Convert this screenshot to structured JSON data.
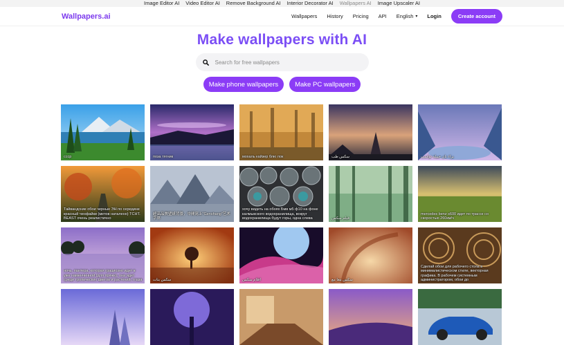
{
  "topbar": {
    "links": [
      "Image Editor AI",
      "Video Editor AI",
      "Remove Background AI",
      "Interior Decorator AI",
      "Wallpapers AI",
      "Image Upscaler AI"
    ],
    "active_index": 4
  },
  "header": {
    "logo": "Wallpapers.ai",
    "nav": {
      "wallpapers": "Wallpapers",
      "history": "History",
      "pricing": "Pricing",
      "api": "API",
      "language": "English",
      "login": "Login",
      "create_account": "Create account"
    }
  },
  "hero": {
    "title": "Make wallpapers with AI",
    "search_placeholder": "Search for free wallpapers",
    "phone_button": "Make phone wallpapers",
    "pc_button": "Make PC wallpapers"
  },
  "colors": {
    "brand": "#8b3cf6",
    "title": "#7b4ef5"
  },
  "gallery": [
    {
      "caption": "ссср",
      "scene": "mountain-lake"
    },
    {
      "caption": "поза тягник",
      "scene": "purple-shore"
    },
    {
      "caption": "мохаль кайзер блю лок",
      "scene": "golden-forest"
    },
    {
      "caption": "سکس طب",
      "scene": "sunset-peak"
    },
    {
      "caption": "بزاء بان جبيلة تواسب",
      "scene": "fantasy-valley"
    },
    {
      "caption": "Тайвандские обои черные ЭН по середине красный ченфайки (метов наталено) TCHT. BEAST очень реалистично",
      "scene": "autumn-road"
    },
    {
      "caption": "超高品質壁紙背景，中間寫上\"Genshang\"艺术字体",
      "scene": "misty-mountains"
    },
    {
      "caption": "хочу видеть на обоях Бмв м5 ф10 на фоне калмыкского водохранилища, вокруг водохранилища будут горы, одна слева",
      "scene": "spheres"
    },
    {
      "caption": "فيلم سكس",
      "scene": "green-forest"
    },
    {
      "caption": "mercedes benz s600 идет по трассе со скоростью 260км/ч",
      "scene": "plains"
    },
    {
      "caption": "ночь, пантера, которая грациозно идет в уже наменченной (для пряже), она идет среди тропических цветов и растений, глаза",
      "scene": "dusk-lake"
    },
    {
      "caption": "سكس بنات",
      "scene": "orange-tree"
    },
    {
      "caption": "افلام سكس",
      "scene": "planet"
    },
    {
      "caption": "سكس معا مع",
      "scene": "swirl"
    },
    {
      "caption": "Сделай обои для рабочего стола в минималистическом стиле, векторная графика. В рабочем системным администратором, обои до",
      "scene": "mandala"
    },
    {
      "caption": "",
      "scene": "castle"
    },
    {
      "caption": "",
      "scene": "tree-of-life"
    },
    {
      "caption": "",
      "scene": "interior"
    },
    {
      "caption": "",
      "scene": "purple-sea"
    },
    {
      "caption": "",
      "scene": "blue-car"
    }
  ]
}
